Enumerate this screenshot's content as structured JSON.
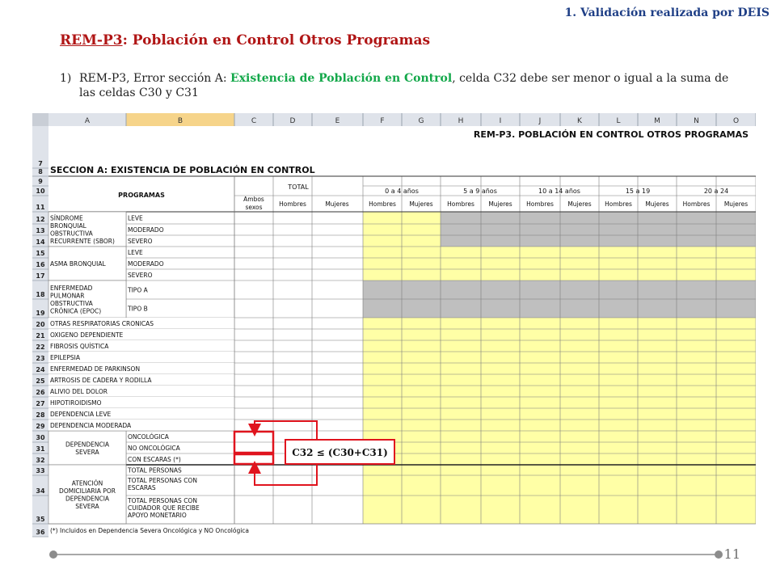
{
  "slide": {
    "top_note": "1.  Validación realizada por DEIS",
    "title_code": "REM-P3",
    "title_rest": ": Población en Control  Otros Programas",
    "point1": {
      "num": "1)",
      "text_a": "REM-P3, Error sección A: ",
      "text_green": "Existencia de Población en Control",
      "text_b": ", celda C32 debe ser menor o igual a la suma de las celdas C30 y C31"
    },
    "page_number": "11"
  },
  "sheet": {
    "col_letters": [
      "A",
      "B",
      "C",
      "D",
      "E",
      "F",
      "G",
      "H",
      "I",
      "J",
      "K",
      "L",
      "M",
      "N",
      "O"
    ],
    "row_numbers": [
      "7",
      "8",
      "9",
      "10",
      "11",
      "12",
      "13",
      "14",
      "15",
      "16",
      "17",
      "18",
      "19",
      "20",
      "21",
      "22",
      "23",
      "24",
      "25",
      "26",
      "27",
      "28",
      "29",
      "30",
      "31",
      "32",
      "33",
      "34",
      "35",
      "36"
    ],
    "title": "REM-P3.   POBLACIÓN EN CONTROL OTROS PROGRAMAS",
    "section": "SECCION A: EXISTENCIA DE POBLACIÓN EN CONTROL",
    "header": {
      "programas": "PROGRAMAS",
      "total": "TOTAL",
      "ambos": "Ambos sexos",
      "hombres": "Hombres",
      "mujeres": "Mujeres",
      "age_groups": [
        "0 a 4 años",
        "5 a 9 años",
        "10 a 14 años",
        "15 a 19",
        "20 a 24"
      ]
    },
    "groups": [
      {
        "label": "SÍNDROME BRONQUIAL OBSTRUCTIVA RECURRENTE (SBOR)",
        "items": [
          "LEVE",
          "MODERADO",
          "SEVERO"
        ]
      },
      {
        "label": "ASMA BRONQUIAL",
        "items": [
          "LEVE",
          "MODERADO",
          "SEVERO"
        ]
      },
      {
        "label": "ENFERMEDAD PULMONAR OBSTRUCTIVA CRÓNICA (EPOC)",
        "items": [
          "TIPO  A",
          "TIPO  B"
        ]
      },
      {
        "label": "DEPENDENCIA SEVERA",
        "items": [
          "ONCOLÓGICA",
          "NO ONCOLÓGICA",
          "CON ESCARAS (*)"
        ]
      },
      {
        "label": "ATENCIÓN DOMICILIARIA POR DEPENDENCIA SEVERA",
        "items": [
          "TOTAL PERSONAS",
          "TOTAL PERSONAS CON ESCARAS",
          "TOTAL PERSONAS CON CUIDADOR QUE RECIBE APOYO MONETARIO"
        ]
      }
    ],
    "single_rows": [
      "OTRAS RESPIRATORIAS CRONICAS",
      "OXIGENO DEPENDIENTE",
      "FIBROSIS QUÍSTICA",
      "EPILEPSIA",
      "ENFERMEDAD DE PARKINSON",
      "ARTROSIS DE CADERA Y RODILLA",
      "ALIVIO DEL DOLOR",
      "HIPOTIROIDISMO",
      "DEPENDENCIA LEVE",
      "DEPENDENCIA MODERADA"
    ],
    "footnote": "(*) Incluidos en Dependencia Severa Oncológica y NO Oncológica",
    "annotation": "C32 ≤ (C30+C31)"
  },
  "colors": {
    "title_red": "#b01515",
    "header_blue": "#1f3f86",
    "highlight_green": "#13a84a",
    "input_yellow": "#ffffa6",
    "blocked_grey": "#bfbfbf",
    "annotation_red": "#e0141e"
  }
}
